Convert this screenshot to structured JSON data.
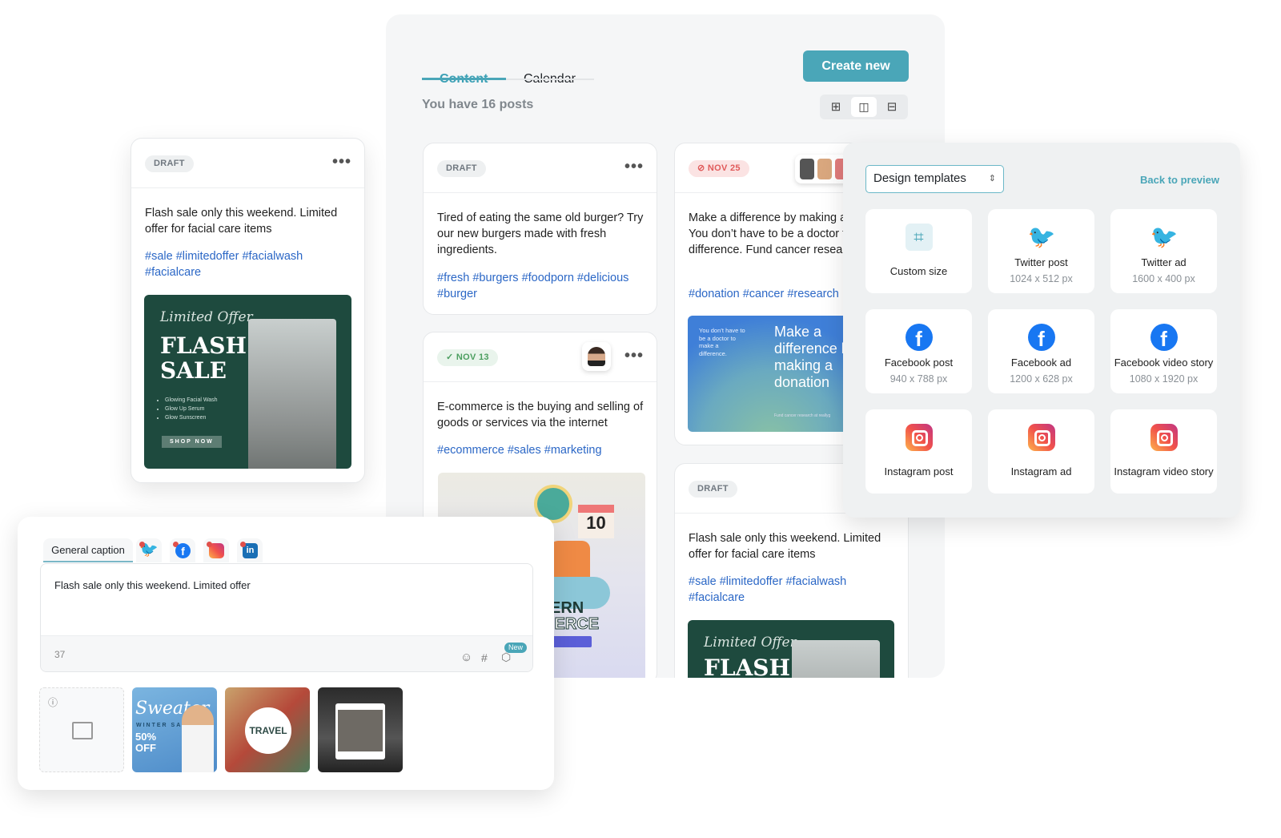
{
  "tabs": [
    {
      "label": "Content",
      "active": true
    },
    {
      "label": "Calendar",
      "active": false
    }
  ],
  "create_button": "Create new",
  "post_count": "You have 16 posts",
  "view_modes": [
    {
      "icon": "grid-icon",
      "active": false
    },
    {
      "icon": "columns-icon",
      "active": true
    },
    {
      "icon": "rows-icon",
      "active": false
    }
  ],
  "colors": {
    "accent": "#4aa6b8",
    "hashtag": "#2b67c6",
    "scheduled_red": "#e05a5a",
    "published_green": "#4b9e5f"
  },
  "floating_card": {
    "badge": "DRAFT",
    "text": "Flash sale only this weekend. Limited offer for facial care items",
    "tags": "#sale #limitedoffer #facialwash #facialcare",
    "image": {
      "script": "Limited Offer",
      "title1": "FLASH",
      "title2": "SALE",
      "bullets": [
        "Glowing Facial Wash",
        "Glow Up Serum",
        "Glow Sunscreen"
      ],
      "cta": "SHOP NOW"
    }
  },
  "posts": [
    {
      "badge": "DRAFT",
      "text": "Tired of eating the same old burger? Try our new burgers made with fresh ingredients.",
      "tags": "#fresh #burgers #foodporn #delicious #burger"
    },
    {
      "badge": "NOV 13",
      "status": "published",
      "text": "E-commerce is the buying and selling of goods or services via the internet",
      "tags": "#ecommerce #sales #marketing",
      "image": {
        "badge_num": "10",
        "title1": "ERN",
        "title2": "IERCE"
      }
    },
    {
      "badge": "NOV 25",
      "status": "scheduled",
      "text": "Make a difference by making a donation. You don’t have to be a doctor to make a difference. Fund cancer research.",
      "tags": "#donation #cancer #research",
      "image": {
        "small": "You don’t have to be a doctor to make a difference.",
        "big": "Make a difference by making a donation",
        "foot": "Fund cancer research at reallyg"
      }
    },
    {
      "badge": "DRAFT",
      "text": "Flash sale only this weekend. Limited offer for facial care items",
      "tags": "#sale #limitedoffer #facialwash #facialcare",
      "image": {
        "script": "Limited Offer",
        "title1": "FLASH"
      }
    }
  ],
  "templates": {
    "select": "Design templates",
    "back": "Back to preview",
    "items": [
      {
        "name": "Custom size",
        "size": "",
        "icon": "crop-icon"
      },
      {
        "name": "Twitter post",
        "size": "1024 x 512 px",
        "icon": "twitter-icon"
      },
      {
        "name": "Twitter ad",
        "size": "1600 x 400 px",
        "icon": "twitter-icon"
      },
      {
        "name": "Facebook post",
        "size": "940 x 788 px",
        "icon": "facebook-icon"
      },
      {
        "name": "Facebook ad",
        "size": "1200 x 628 px",
        "icon": "facebook-icon"
      },
      {
        "name": "Facebook video story",
        "size": "1080 x 1920 px",
        "icon": "facebook-icon"
      },
      {
        "name": "Instagram post",
        "size": "",
        "icon": "instagram-icon"
      },
      {
        "name": "Instagram ad",
        "size": "",
        "icon": "instagram-icon"
      },
      {
        "name": "Instagram video story",
        "size": "",
        "icon": "instagram-icon"
      }
    ]
  },
  "caption": {
    "tab": "General caption",
    "networks": [
      "twitter",
      "facebook",
      "instagram",
      "linkedin"
    ],
    "text": "Flash sale only this weekend. Limited offer",
    "count": "37",
    "new_badge": "New",
    "thumbs": [
      {
        "title": "Sweater",
        "sub": "WINTER SALE",
        "offer": "50% OFF"
      },
      {
        "title": "TRAVEL"
      },
      {}
    ]
  }
}
